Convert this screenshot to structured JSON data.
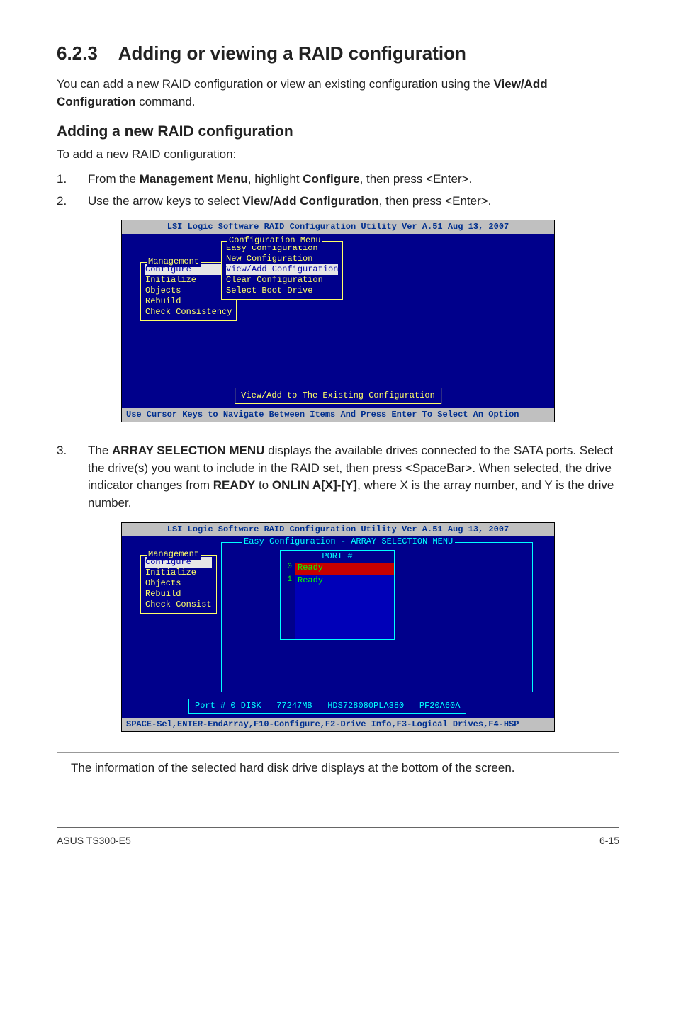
{
  "section": {
    "number": "6.2.3",
    "title": "Adding or viewing a RAID configuration",
    "intro": "You can add a new RAID configuration or view an existing configuration using the ",
    "intro_bold": "View/Add Configuration",
    "intro_tail": " command."
  },
  "sub": {
    "title": "Adding a new RAID configuration",
    "lead": "To add a new RAID configuration:"
  },
  "steps": {
    "s1_a": "From the ",
    "s1_b": "Management Menu",
    "s1_c": ", highlight ",
    "s1_d": "Configure",
    "s1_e": ", then press <Enter>.",
    "s2_a": "Use the arrow keys to select ",
    "s2_b": "View/Add Configuration",
    "s2_c": ", then press <Enter>.",
    "s3_a": "The ",
    "s3_b": "ARRAY SELECTION MENU",
    "s3_c": " displays the available drives connected to the SATA ports. Select the drive(s) you want to include in the RAID set, then press <SpaceBar>. When selected, the drive indicator changes from ",
    "s3_d": "READY",
    "s3_e": " to ",
    "s3_f": "ONLIN A[X]-[Y]",
    "s3_g": ", where X is the array number, and Y is the drive number."
  },
  "ss1": {
    "title": "LSI Logic Software RAID Configuration Utility Ver A.51 Aug 13, 2007",
    "mgmt_label": "Management",
    "mgmt_items": [
      "Configure",
      "Initialize",
      "Objects",
      "Rebuild",
      "Check Consistency"
    ],
    "cfg_label": "Configuration Menu",
    "cfg_items": [
      "Easy Configuration",
      "New Configuration",
      "View/Add Configuration",
      "Clear Configuration",
      "Select Boot Drive"
    ],
    "status": "View/Add to The Existing Configuration",
    "footer": "Use Cursor Keys to Navigate Between Items And Press Enter To Select An Option"
  },
  "ss2": {
    "title": "LSI Logic Software RAID Configuration Utility Ver A.51 Aug 13, 2007",
    "mgmt_label": "Management",
    "mgmt_items": [
      "Configure",
      "Initialize",
      "Objects",
      "Rebuild",
      "Check Consist"
    ],
    "array_label": "Easy Configuration - ARRAY SELECTION MENU",
    "port_header": "PORT #",
    "ports": [
      {
        "idx": "0",
        "state": "Ready",
        "sel": true
      },
      {
        "idx": "1",
        "state": "Ready",
        "sel": false
      }
    ],
    "disk_info": "Port # 0 DISK   77247MB   HDS728080PLA380   PF20A60A",
    "footer": "SPACE-Sel,ENTER-EndArray,F10-Configure,F2-Drive Info,F3-Logical Drives,F4-HSP"
  },
  "note": "The information of the selected hard disk drive displays at the bottom of the screen.",
  "footer": {
    "left": "ASUS TS300-E5",
    "right": "6-15"
  }
}
